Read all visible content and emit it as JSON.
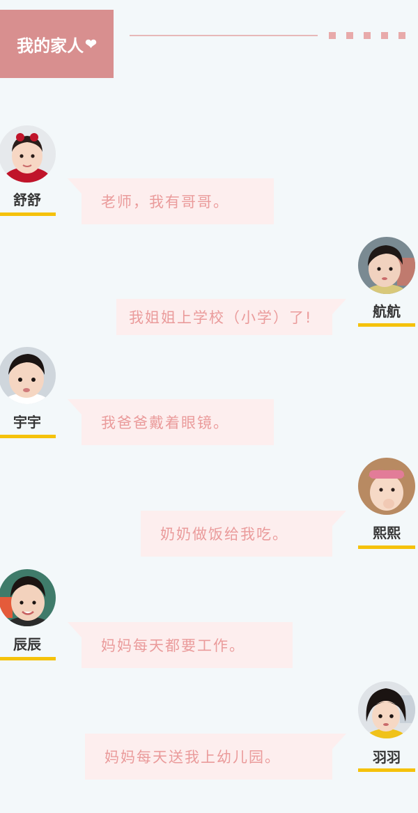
{
  "header": {
    "title": "我的家人",
    "heart": "❤"
  },
  "messages": [
    {
      "name": "舒舒",
      "text": "老师，我有哥哥。",
      "side": "left"
    },
    {
      "name": "航航",
      "text": "我姐姐上学校（小学）了!",
      "side": "right"
    },
    {
      "name": "宇宇",
      "text": "我爸爸戴着眼镜。",
      "side": "left"
    },
    {
      "name": "熙熙",
      "text": "奶奶做饭给我吃。",
      "side": "right"
    },
    {
      "name": "辰辰",
      "text": "妈妈每天都要工作。",
      "side": "left"
    },
    {
      "name": "羽羽",
      "text": "妈妈每天送我上幼儿园。",
      "side": "right"
    }
  ],
  "colors": {
    "background": "#f3f8fa",
    "title_bg": "#d88f8f",
    "bubble_bg": "#fdeeee",
    "bubble_text": "#ea9b9b",
    "name_underline": "#f5c20b"
  }
}
